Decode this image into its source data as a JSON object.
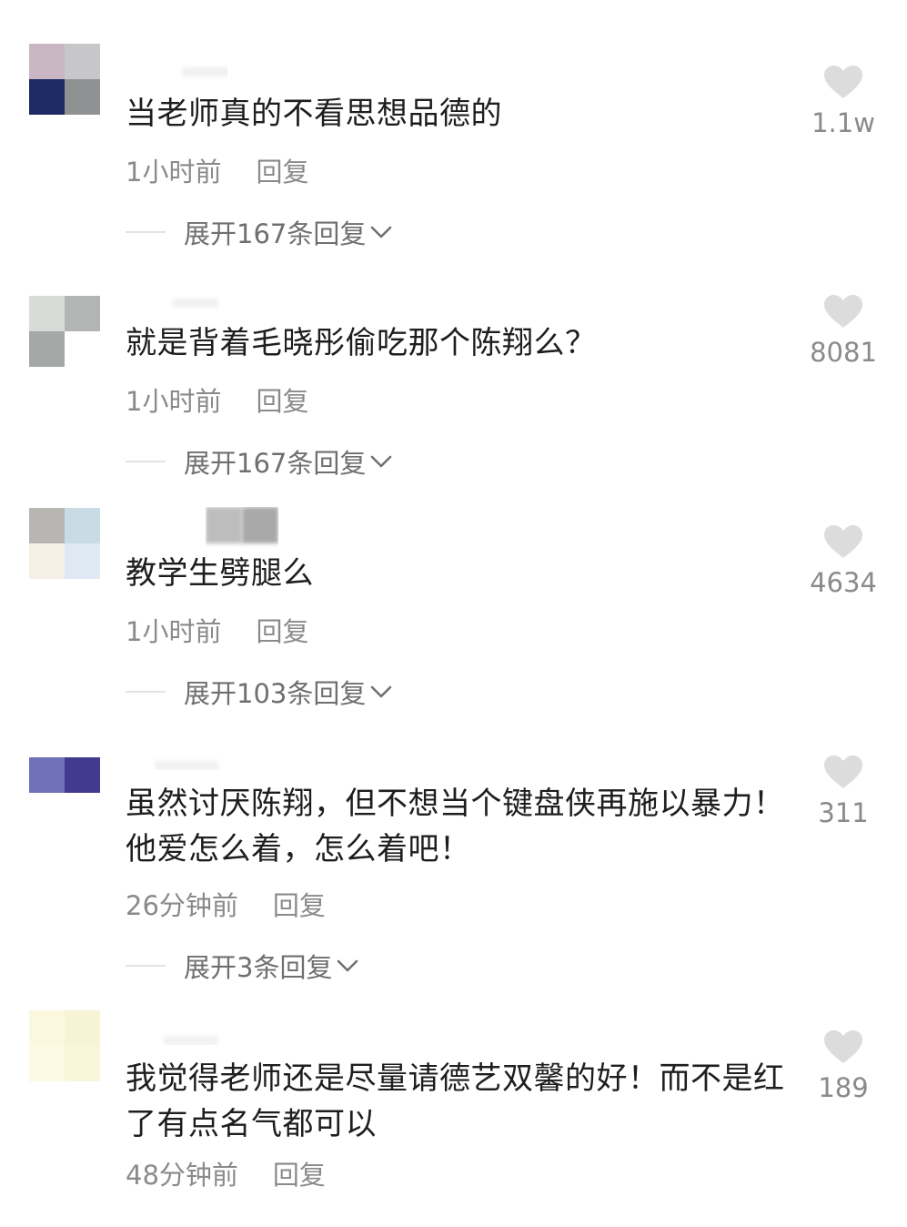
{
  "comments": [
    {
      "text": "当老师真的不看思想品德的",
      "time": "1小时前",
      "reply_label": "回复",
      "expand_label": "展开167条回复",
      "likes": "1.1w"
    },
    {
      "text": "就是背着毛晓彤偷吃那个陈翔么？",
      "time": "1小时前",
      "reply_label": "回复",
      "expand_label": "展开167条回复",
      "likes": "8081"
    },
    {
      "text": "教学生劈腿么",
      "time": "1小时前",
      "reply_label": "回复",
      "expand_label": "展开103条回复",
      "likes": "4634"
    },
    {
      "text": "虽然讨厌陈翔，但不想当个键盘侠再施以暴力！他爱怎么着，怎么着吧！",
      "time": "26分钟前",
      "reply_label": "回复",
      "expand_label": "展开3条回复",
      "likes": "311"
    },
    {
      "text": "我觉得老师还是尽量请德艺双馨的好！而不是红了有点名气都可以",
      "time": "48分钟前",
      "reply_label": "回复",
      "likes": "189"
    }
  ],
  "colors": {
    "text": "#1e1e1e",
    "meta": "#8a8a8a",
    "expand": "#6f6f6f",
    "heart": "#dcdcdc"
  },
  "icons": {
    "like": "heart-icon",
    "expand": "chevron-down-icon"
  }
}
